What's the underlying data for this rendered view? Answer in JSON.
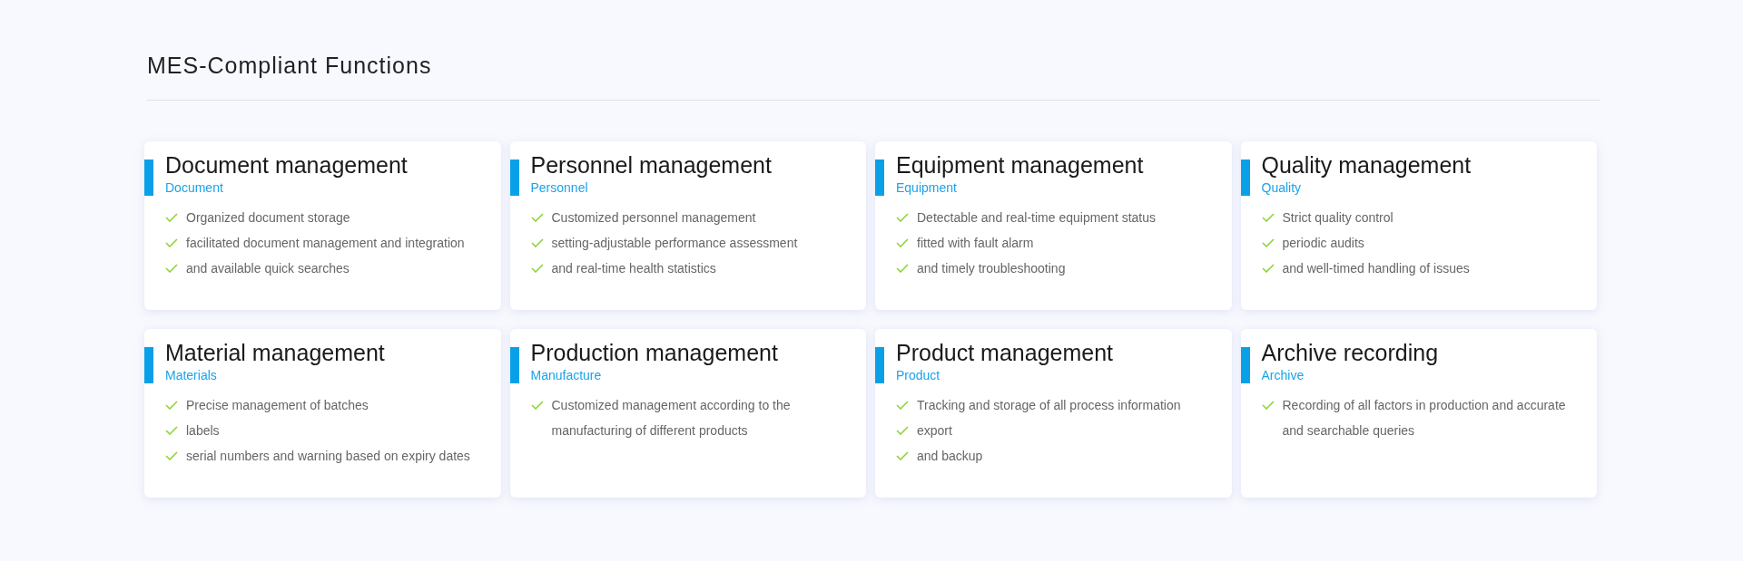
{
  "title": "MES-Compliant Functions",
  "cards": [
    {
      "title": "Document management",
      "subtitle": "Document",
      "items": [
        "Organized document storage",
        "facilitated document management and integration",
        "and available quick searches"
      ]
    },
    {
      "title": "Personnel management",
      "subtitle": "Personnel",
      "items": [
        "Customized personnel management",
        "setting-adjustable performance assessment",
        "and real-time health statistics"
      ]
    },
    {
      "title": "Equipment management",
      "subtitle": "Equipment",
      "items": [
        "Detectable and real-time equipment status",
        "fitted with fault alarm",
        "and timely troubleshooting"
      ]
    },
    {
      "title": "Quality management",
      "subtitle": "Quality",
      "items": [
        "Strict quality control",
        "periodic audits",
        "and well-timed handling of issues"
      ]
    },
    {
      "title": "Material management",
      "subtitle": "Materials",
      "items": [
        "Precise management of batches",
        "labels",
        "serial numbers and warning based on expiry dates"
      ]
    },
    {
      "title": "Production management",
      "subtitle": "Manufacture",
      "items": [
        "Customized management according to the manufacturing of different products"
      ]
    },
    {
      "title": "Product management",
      "subtitle": "Product",
      "items": [
        "Tracking and storage of all process information",
        "export",
        "and backup"
      ]
    },
    {
      "title": "Archive recording",
      "subtitle": "Archive",
      "items": [
        "Recording of all factors in production and accurate and searchable queries"
      ]
    }
  ]
}
